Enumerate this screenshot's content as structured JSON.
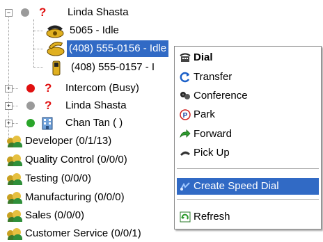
{
  "tree": {
    "rows": [
      {
        "label": "Linda Shasta"
      },
      {
        "label": "5065 - Idle"
      },
      {
        "label": "(408) 555-0156 - Idle"
      },
      {
        "label": "(408) 555-0157 - I"
      },
      {
        "label": "Intercom (Busy)"
      },
      {
        "label": "Linda Shasta"
      },
      {
        "label": "Chan Tan ( )"
      },
      {
        "label": "Developer  (0/1/13)"
      },
      {
        "label": "Quality Control  (0/0/0)"
      },
      {
        "label": "Testing  (0/0/0)"
      },
      {
        "label": "Manufacturing  (0/0/0)"
      },
      {
        "label": "Sales  (0/0/0)"
      },
      {
        "label": "Customer Service  (0/0/1)"
      }
    ],
    "expand_symbols": {
      "collapse": "−",
      "expand": "+"
    },
    "status_icon": "?"
  },
  "context_menu": {
    "items": [
      {
        "label": "Dial",
        "icon": "dial-icon"
      },
      {
        "label": "Transfer",
        "icon": "transfer-icon"
      },
      {
        "label": "Conference",
        "icon": "conference-icon"
      },
      {
        "label": "Park",
        "icon": "park-icon"
      },
      {
        "label": "Forward",
        "icon": "forward-icon"
      },
      {
        "label": "Pick Up",
        "icon": "pickup-icon"
      },
      {
        "label": "Create Speed Dial",
        "icon": "speed-dial-icon"
      },
      {
        "label": "Refresh",
        "icon": "refresh-icon"
      }
    ],
    "park_glyph": "P"
  },
  "colors": {
    "selection": "#316ac5",
    "status_red": "#e01010",
    "status_green": "#2aa52a",
    "status_gray": "#9a9a9a"
  }
}
